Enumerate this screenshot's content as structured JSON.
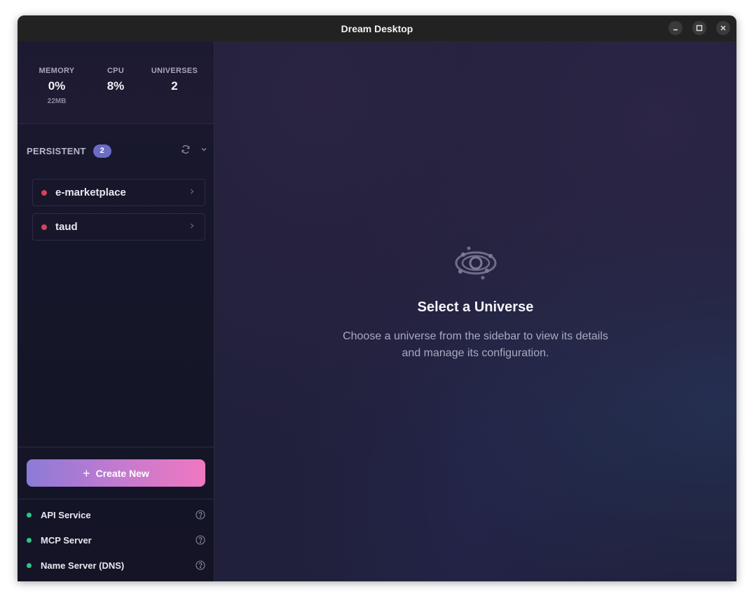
{
  "window": {
    "title": "Dream Desktop",
    "controls": [
      "minimize-icon",
      "maximize-icon",
      "close-icon"
    ]
  },
  "stats": {
    "memory": {
      "label": "MEMORY",
      "value": "0%",
      "sub": "22MB"
    },
    "cpu": {
      "label": "CPU",
      "value": "8%"
    },
    "universes": {
      "label": "UNIVERSES",
      "value": "2"
    }
  },
  "persistent": {
    "label": "PERSISTENT",
    "count": "2",
    "items": [
      {
        "label": "e-marketplace",
        "status": "stopped"
      },
      {
        "label": "taud",
        "status": "stopped"
      }
    ]
  },
  "create_button": {
    "label": "Create New"
  },
  "services": [
    {
      "label": "API Service",
      "status": "running"
    },
    {
      "label": "MCP Server",
      "status": "running"
    },
    {
      "label": "Name Server (DNS)",
      "status": "running"
    }
  ],
  "empty_state": {
    "title": "Select a Universe",
    "description": "Choose a universe from the sidebar to view its details and manage its configuration."
  },
  "colors": {
    "accent": "#6b6bc8",
    "stopped": "#d2445c",
    "running": "#2fc58a",
    "gradient_start": "#8b7bd8",
    "gradient_end": "#f078c0"
  }
}
